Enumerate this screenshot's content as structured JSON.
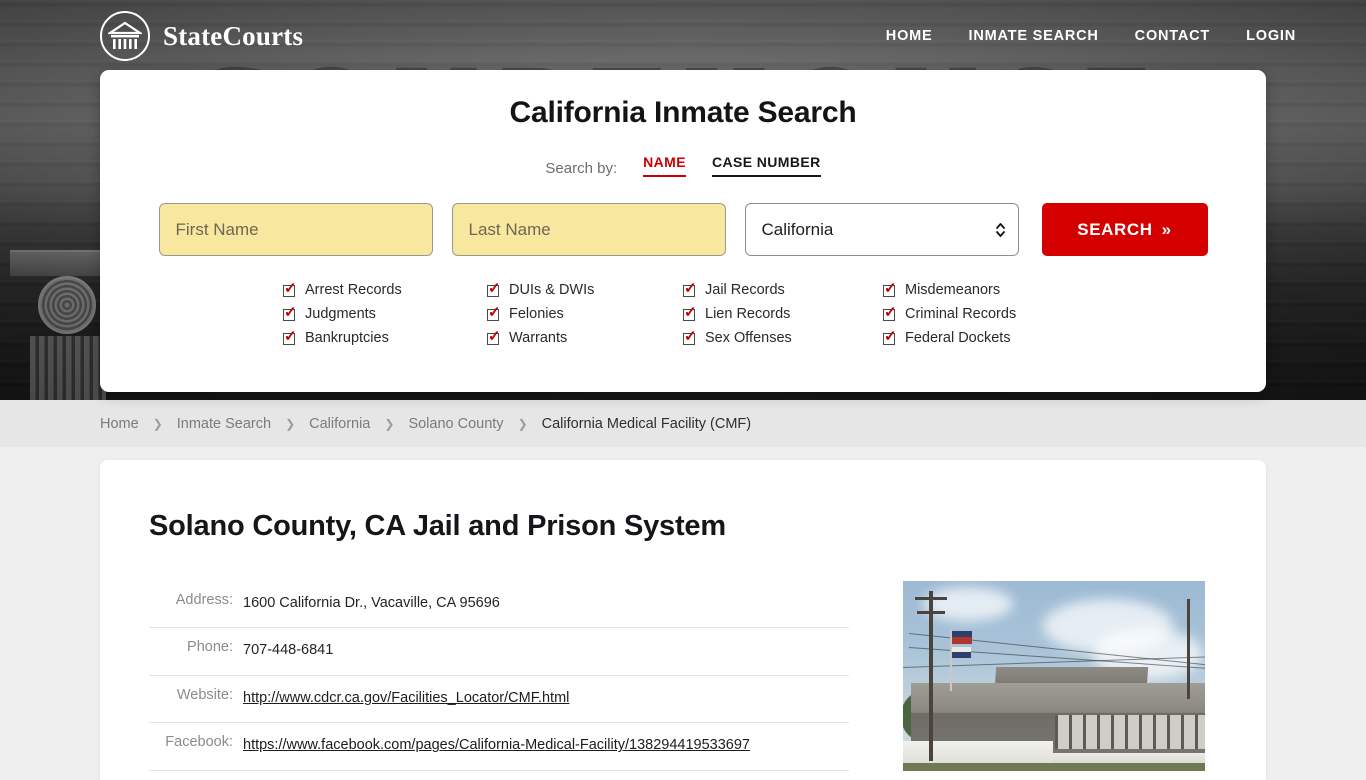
{
  "header": {
    "brand_name": "StateCourts",
    "brand_icon": "courthouse-circle-icon",
    "nav": [
      {
        "label": "HOME"
      },
      {
        "label": "INMATE SEARCH"
      },
      {
        "label": "CONTACT"
      },
      {
        "label": "LOGIN"
      }
    ]
  },
  "search_card": {
    "title": "California Inmate Search",
    "search_by_label": "Search by:",
    "tabs": [
      {
        "label": "NAME",
        "active": true
      },
      {
        "label": "CASE NUMBER",
        "active": false
      }
    ],
    "first_name": {
      "placeholder": "First Name",
      "value": ""
    },
    "last_name": {
      "placeholder": "Last Name",
      "value": ""
    },
    "state_select": {
      "value": "California",
      "options": [
        "California"
      ]
    },
    "search_button": {
      "label": "SEARCH",
      "chevron": "»"
    },
    "record_types": [
      "Arrest Records",
      "DUIs & DWIs",
      "Jail Records",
      "Misdemeanors",
      "Judgments",
      "Felonies",
      "Lien Records",
      "Criminal Records",
      "Bankruptcies",
      "Warrants",
      "Sex Offenses",
      "Federal Dockets"
    ]
  },
  "breadcrumb": {
    "separator": "❯",
    "items": [
      {
        "label": "Home",
        "current": false
      },
      {
        "label": "Inmate Search",
        "current": false
      },
      {
        "label": "California",
        "current": false
      },
      {
        "label": "Solano County",
        "current": false
      },
      {
        "label": "California Medical Facility (CMF)",
        "current": true
      }
    ]
  },
  "content": {
    "title": "Solano County, CA Jail and Prison System",
    "details": [
      {
        "label": "Address:",
        "value": "1600 California Dr., Vacaville, CA 95696",
        "is_link": false
      },
      {
        "label": "Phone:",
        "value": "707-448-6841",
        "is_link": false
      },
      {
        "label": "Website:",
        "value": "http://www.cdcr.ca.gov/Facilities_Locator/CMF.html",
        "is_link": true
      },
      {
        "label": "Facebook:",
        "value": "https://www.facebook.com/pages/California-Medical-Facility/138294419533697",
        "is_link": true
      }
    ],
    "photo_caption": "facility-photo"
  },
  "hero": {
    "background_text": "COURTHOUSE"
  },
  "colors": {
    "accent_red": "#cc0000",
    "button_red": "#d40000",
    "field_yellow": "#f8e79e",
    "page_background": "#efefef",
    "breadcrumb_background": "#e6e6e6"
  }
}
